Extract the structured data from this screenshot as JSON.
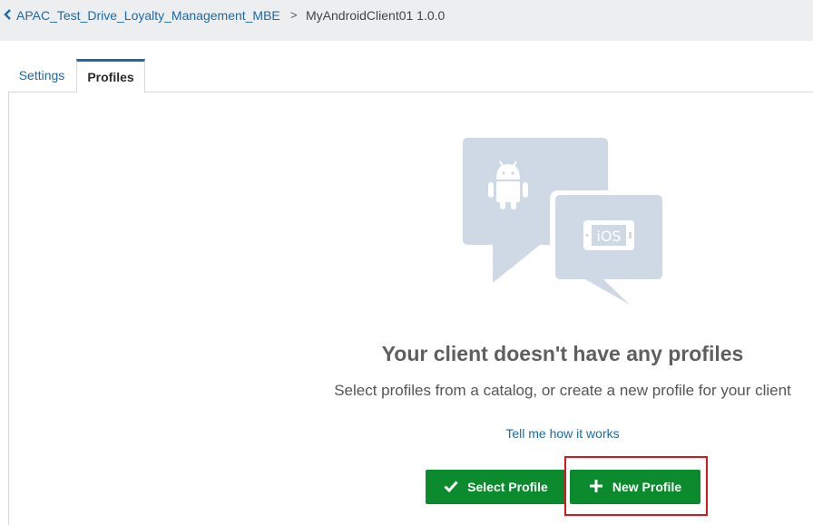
{
  "breadcrumb": {
    "back_label": "APAC_Test_Drive_Loyalty_Management_MBE",
    "separator": ">",
    "current": "MyAndroidClient01  1.0.0"
  },
  "tabs": [
    {
      "label": "Settings",
      "active": false
    },
    {
      "label": "Profiles",
      "active": true
    }
  ],
  "illustration": {
    "icons": [
      "android-icon",
      "ios-icon"
    ],
    "ios_label": "iOS",
    "bubble_color": "#cfd9e5"
  },
  "empty_state": {
    "title": "Your client doesn't have any profiles",
    "subtitle": "Select profiles from a catalog, or create a new profile for your client",
    "help_link": "Tell me how it works"
  },
  "actions": {
    "select_profile": "Select Profile",
    "new_profile": "New Profile"
  },
  "colors": {
    "accent": "#1c6aa8",
    "button_green": "#0b8a2e",
    "highlight_red": "#d9161c"
  }
}
